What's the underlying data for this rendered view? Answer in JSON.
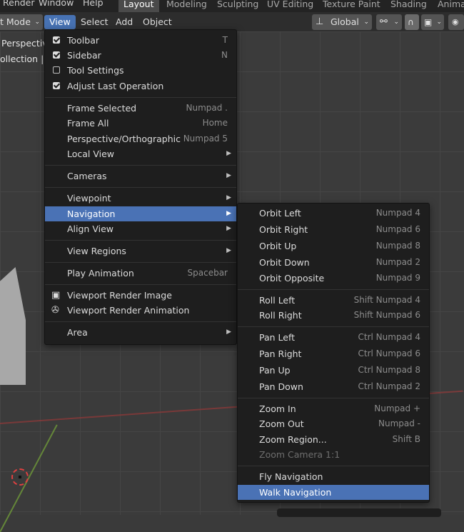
{
  "topbar": {
    "menus": [
      "Render",
      "Window",
      "Help"
    ],
    "workspaces": [
      "Layout",
      "Modeling",
      "Sculpting",
      "UV Editing",
      "Texture Paint",
      "Shading",
      "Animati"
    ]
  },
  "header": {
    "mode": "t Mode",
    "menus": [
      "View",
      "Select",
      "Add",
      "Object"
    ],
    "orientation": "Global"
  },
  "overlay": {
    "line1": "Perspective",
    "line2": "ollection | C"
  },
  "view_menu": {
    "items": [
      {
        "label": "Toolbar",
        "shortcut": "T"
      },
      {
        "label": "Sidebar",
        "shortcut": "N"
      },
      {
        "label": "Tool Settings"
      },
      {
        "label": "Adjust Last Operation"
      },
      {
        "label": "Frame Selected",
        "shortcut": "Numpad ."
      },
      {
        "label": "Frame All",
        "shortcut": "Home"
      },
      {
        "label": "Perspective/Orthographic",
        "shortcut": "Numpad 5"
      },
      {
        "label": "Local View"
      },
      {
        "label": "Cameras"
      },
      {
        "label": "Viewpoint"
      },
      {
        "label": "Navigation"
      },
      {
        "label": "Align View"
      },
      {
        "label": "View Regions"
      },
      {
        "label": "Play Animation",
        "shortcut": "Spacebar"
      },
      {
        "label": "Viewport Render Image"
      },
      {
        "label": "Viewport Render Animation"
      },
      {
        "label": "Area"
      }
    ]
  },
  "nav_menu": {
    "items": [
      {
        "label": "Orbit Left",
        "shortcut": "Numpad 4"
      },
      {
        "label": "Orbit Right",
        "shortcut": "Numpad 6"
      },
      {
        "label": "Orbit Up",
        "shortcut": "Numpad 8"
      },
      {
        "label": "Orbit Down",
        "shortcut": "Numpad 2"
      },
      {
        "label": "Orbit Opposite",
        "shortcut": "Numpad 9"
      },
      {
        "label": "Roll Left",
        "shortcut": "Shift Numpad 4"
      },
      {
        "label": "Roll Right",
        "shortcut": "Shift Numpad 6"
      },
      {
        "label": "Pan Left",
        "shortcut": "Ctrl Numpad 4"
      },
      {
        "label": "Pan Right",
        "shortcut": "Ctrl Numpad 6"
      },
      {
        "label": "Pan Up",
        "shortcut": "Ctrl Numpad 8"
      },
      {
        "label": "Pan Down",
        "shortcut": "Ctrl Numpad 2"
      },
      {
        "label": "Zoom In",
        "shortcut": "Numpad +"
      },
      {
        "label": "Zoom Out",
        "shortcut": "Numpad -"
      },
      {
        "label": "Zoom Region...",
        "shortcut": "Shift B"
      },
      {
        "label": "Zoom Camera 1:1"
      },
      {
        "label": "Fly Navigation"
      },
      {
        "label": "Walk Navigation"
      }
    ]
  },
  "colors": {
    "highlight": "#4a72b5",
    "menu_bg": "#1e1e1e"
  }
}
